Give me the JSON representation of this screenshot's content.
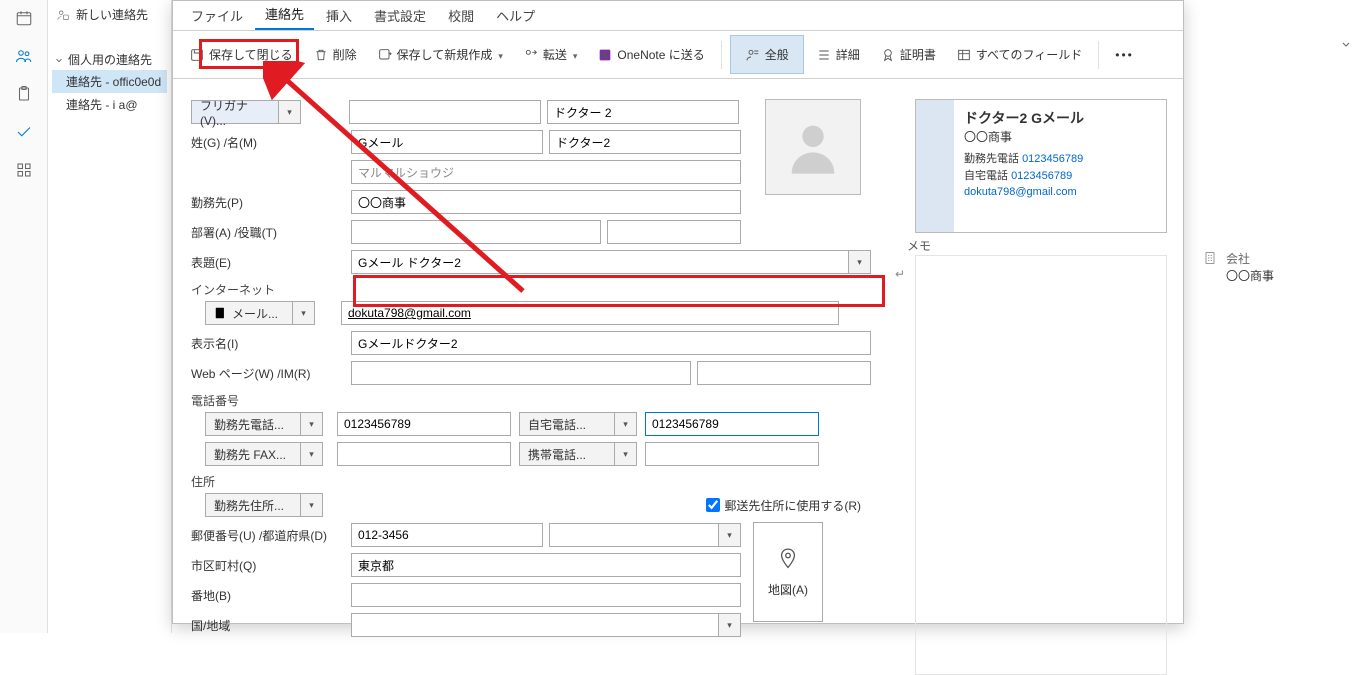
{
  "rail": {
    "items": [
      "calendar",
      "people",
      "clipboard",
      "check",
      "grid"
    ]
  },
  "list": {
    "new_contact": "新しい連絡先",
    "folder_header": "個人用の連絡先",
    "entries": [
      {
        "label": "連絡先 - offic0e0d",
        "selected": true
      },
      {
        "label": "連絡先 - i          a@",
        "selected": false
      }
    ]
  },
  "menu": {
    "tabs": [
      {
        "label": "ファイル",
        "active": false
      },
      {
        "label": "連絡先",
        "active": true
      },
      {
        "label": "挿入",
        "active": false
      },
      {
        "label": "書式設定",
        "active": false
      },
      {
        "label": "校閲",
        "active": false
      },
      {
        "label": "ヘルプ",
        "active": false
      }
    ]
  },
  "toolbar": {
    "save_close": "保存して閉じる",
    "delete": "削除",
    "save_new": "保存して新規作成",
    "forward": "転送",
    "onenote": "OneNote に送る",
    "general": "全般",
    "details": "詳細",
    "cert": "証明書",
    "all_fields": "すべてのフィールド"
  },
  "form": {
    "furigana_btn": "フリガナ(V)...",
    "name_lbl": "姓(G)  /名(M)",
    "surname": "Gメール",
    "given": "ドクター2",
    "furigana_surname": "",
    "furigana_given": "ドクター 2",
    "company_phonetic": "マルマルショウジ",
    "company_lbl": "勤務先(P)",
    "company": "〇〇商事",
    "dept_lbl": "部署(A)  /役職(T)",
    "dept": "",
    "role": "",
    "subject_lbl": "表題(E)",
    "subject": "Gメール ドクター2",
    "internet_hdr": "インターネット",
    "mail_btn": "メール...",
    "email": "dokuta798@gmail.com",
    "display_lbl": "表示名(I)",
    "display": "Gメールドクター2",
    "web_lbl": "Web ページ(W)  /IM(R)",
    "web": "",
    "im": "",
    "phone_hdr": "電話番号",
    "work_phone_btn": "勤務先電話...",
    "work_phone": "0123456789",
    "home_phone_btn": "自宅電話...",
    "home_phone": "0123456789",
    "work_fax_btn": "勤務先 FAX...",
    "work_fax": "",
    "mobile_btn": "携帯電話...",
    "mobile": "",
    "addr_hdr": "住所",
    "work_addr_btn": "勤務先住所...",
    "mailing_chk": "郵送先住所に使用する(R)",
    "zip_lbl": "郵便番号(U)  /都道府県(D)",
    "zip": "012-3456",
    "pref": "",
    "city_lbl": "市区町村(Q)",
    "city": "東京都",
    "street_lbl": "番地(B)",
    "street": "",
    "country_lbl": "国/地域",
    "country": "",
    "map_btn": "地図(A)"
  },
  "preview": {
    "name": "ドクター2 Gメール",
    "org": "〇〇商事",
    "work_phone_lbl": "勤務先電話",
    "work_phone": "0123456789",
    "home_phone_lbl": "自宅電話",
    "home_phone": "0123456789",
    "email": "dokuta798@gmail.com"
  },
  "memo_label": "メモ",
  "side": {
    "company_lbl": "会社",
    "company": "〇〇商事"
  }
}
